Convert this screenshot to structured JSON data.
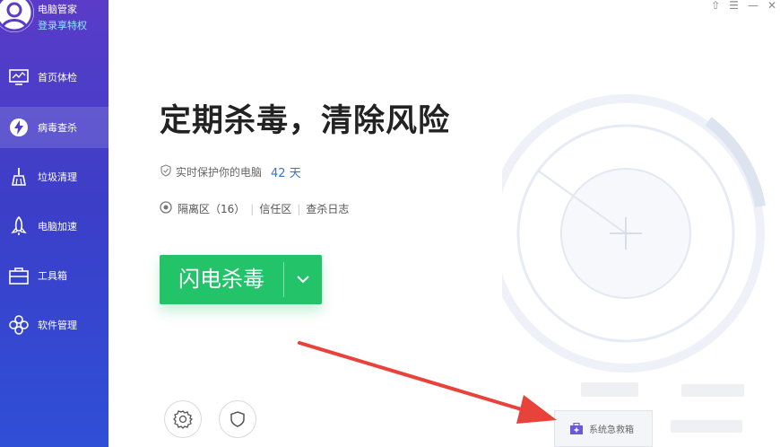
{
  "app": {
    "name": "电脑管家",
    "login_text": "登录享特权"
  },
  "window_controls": {
    "skin": "⇧",
    "menu": "☰",
    "minimize": "—",
    "close": "✕"
  },
  "sidebar": {
    "items": [
      {
        "label": "首页体检",
        "icon": "monitor-icon",
        "active": false
      },
      {
        "label": "病毒查杀",
        "icon": "lightning-icon",
        "active": true
      },
      {
        "label": "垃圾清理",
        "icon": "broom-icon",
        "active": false
      },
      {
        "label": "电脑加速",
        "icon": "rocket-icon",
        "active": false
      },
      {
        "label": "工具箱",
        "icon": "toolbox-icon",
        "active": false
      },
      {
        "label": "软件管理",
        "icon": "apps-icon",
        "active": false
      }
    ]
  },
  "main": {
    "headline": "定期杀毒，清除风险",
    "protect_text": "实时保护你的电脑",
    "protect_days": "42 天",
    "quarantine": "隔离区（16）",
    "trust_zone": "信任区",
    "scan_log": "查杀日志",
    "scan_button": "闪电杀毒",
    "rescue_label": "系统急救箱"
  },
  "colors": {
    "sidebar_top": "#5a3cc8",
    "sidebar_bottom": "#2f4fd6",
    "accent_green": "#23c36a",
    "link_blue": "#3a6fd0",
    "arrow_red": "#e8423a"
  }
}
